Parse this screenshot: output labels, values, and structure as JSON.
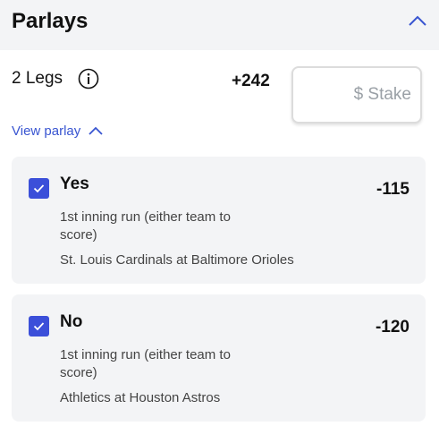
{
  "header": {
    "title": "Parlays"
  },
  "parlay": {
    "legs_label": "2 Legs",
    "odds": "+242",
    "stake_placeholder": "$ Stake",
    "view_parlay_label": "View parlay"
  },
  "legs": [
    {
      "checked": true,
      "pick": "Yes",
      "price": "-115",
      "market": "1st inning run (either team to score)",
      "matchup": "St. Louis Cardinals at Baltimore Orioles"
    },
    {
      "checked": true,
      "pick": "No",
      "price": "-120",
      "market": "1st inning run (either team to score)",
      "matchup": "Athletics at Houston Astros"
    }
  ],
  "colors": {
    "accent": "#3b4fd9",
    "link": "#3955d1",
    "panel": "#f3f4f6"
  }
}
